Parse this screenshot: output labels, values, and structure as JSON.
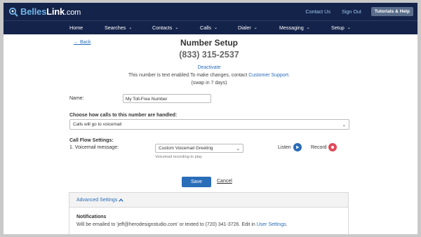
{
  "header": {
    "logo_part1": "Belles",
    "logo_part2": "Link",
    "logo_part3": ".com",
    "contact_us": "Contact Us",
    "sign_out": "Sign Out",
    "tutorials": "Tutorials & Help"
  },
  "nav": {
    "items": [
      {
        "label": "Home"
      },
      {
        "label": "Searches"
      },
      {
        "label": "Contacts"
      },
      {
        "label": "Calls"
      },
      {
        "label": "Dialer"
      },
      {
        "label": "Messaging"
      },
      {
        "label": "Setup"
      }
    ],
    "caret": "⌄"
  },
  "page": {
    "back": "← Back",
    "title": "Number Setup",
    "phone": "(833) 315-2537",
    "deactivate": "Deactivate",
    "notice_text": "This number is text enabled.To make changes, contact ",
    "notice_link": "Customer Support",
    "notice_end": ".",
    "swap": "(swap in 7 days)"
  },
  "form": {
    "name_label": "Name:",
    "name_value": "My Toll-Free Number",
    "handling_label": "Choose how calls to this number are handled:",
    "handling_value": "Calls will go to voicemail",
    "flow_label": "Call Flow Settings:",
    "voicemail_label": "1. Voicemail message:",
    "voicemail_value": "Custom Voicemail Greeting",
    "voicemail_hint": "Voicemail recording to play",
    "listen": "Listen",
    "record": "Record",
    "save": "Save",
    "cancel": "Cancel"
  },
  "advanced": {
    "label": "Advanced Settings",
    "notifications_title": "Notifications",
    "notifications_text": "Will be emailed to 'jeff@herodesignstudio.com' or texted to (720) 341-3726. Edit in ",
    "notifications_link": "User Settings",
    "notifications_end": "."
  },
  "colors": {
    "nav_bg": "#14234a",
    "link": "#2a6db8",
    "record": "#e14a5b"
  }
}
